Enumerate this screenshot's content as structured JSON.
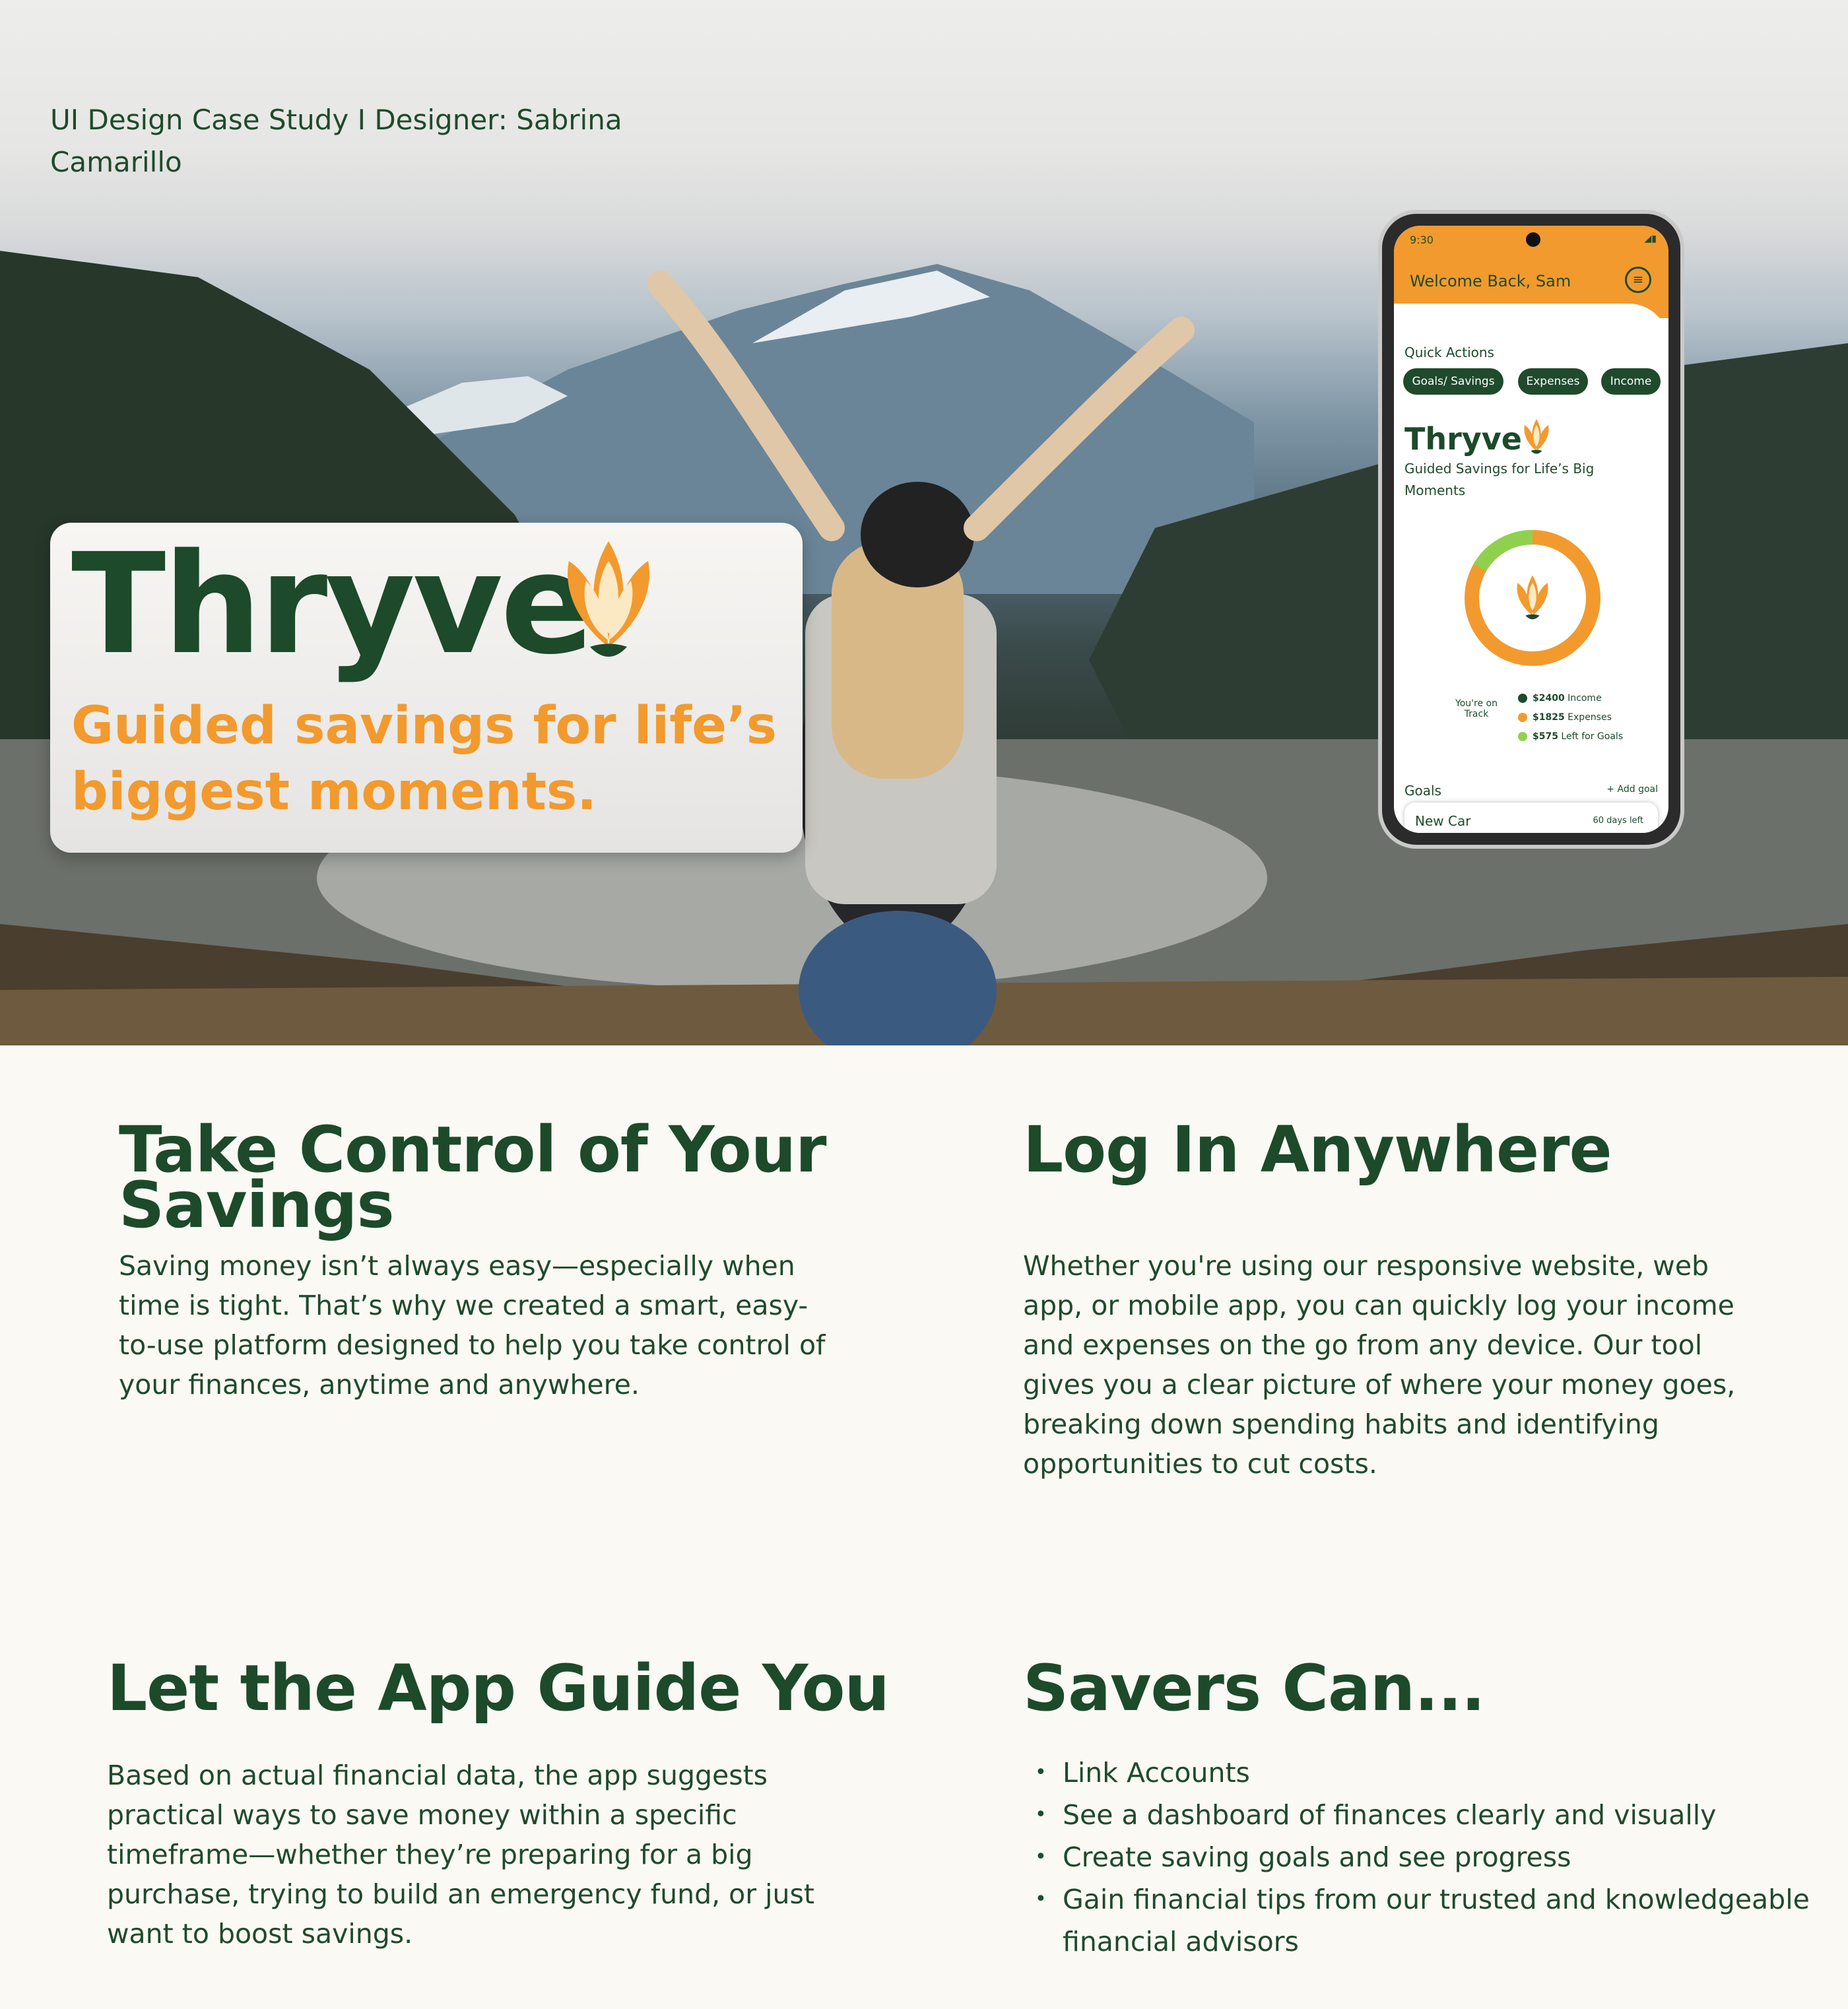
{
  "caption": "UI Design Case Study  I  Designer: Sabrina Camarillo",
  "brand": {
    "name": "Thryve",
    "tagline": "Guided savings for life’s biggest moments.",
    "orange": "#f29a2e",
    "green": "#1c4a2a",
    "light_green": "#8fd14f",
    "logo_icon": "flower-bud-icon"
  },
  "phone": {
    "time": "9:30",
    "welcome": "Welcome Back, Sam",
    "menu_icon": "menu-lines-icon",
    "quick_actions_title": "Quick Actions",
    "quick_actions": [
      "Goals/ Savings",
      "Expenses",
      "Income"
    ],
    "brand_name": "Thryve",
    "brand_tag": "Guided Savings for Life’s Big Moments",
    "track_label": "You're on Track",
    "legend": [
      {
        "amount": "$2400",
        "label": "Income",
        "color": "#1c4a2a"
      },
      {
        "amount": "$1825",
        "label": "Expenses",
        "color": "#f29a2e"
      },
      {
        "amount": "$575",
        "label": "Left for Goals",
        "color": "#8fd14f"
      }
    ],
    "goals_title": "Goals",
    "add_goal": "+ Add goal",
    "goal": {
      "name": "New Car",
      "days_left": "60 days left"
    }
  },
  "sections": {
    "control": {
      "title": "Take Control of Your Savings",
      "body": "Saving money isn’t always easy—especially when time is tight. That’s why we created a smart, easy-to-use platform designed to help you take control of your finances, anytime and anywhere."
    },
    "login": {
      "title": "Log In Anywhere",
      "body": "Whether you're using our responsive website, web app, or mobile app, you can quickly log your income and expenses on the go from any device. Our tool gives you a clear picture of where your money goes, breaking down spending habits and identifying opportunities to cut costs."
    },
    "guide": {
      "title": "Let the App Guide You",
      "body": "Based on actual financial data, the app suggests practical ways to save money within a specific timeframe—whether they’re preparing for a big purchase, trying to build an emergency fund, or just want to boost savings."
    },
    "savers": {
      "title": "Savers Can...",
      "items": [
        "Link Accounts",
        " See a dashboard of finances clearly and visually",
        "Create saving goals and see progress",
        "Gain financial tips from our trusted and knowledgeable financial advisors"
      ]
    }
  }
}
